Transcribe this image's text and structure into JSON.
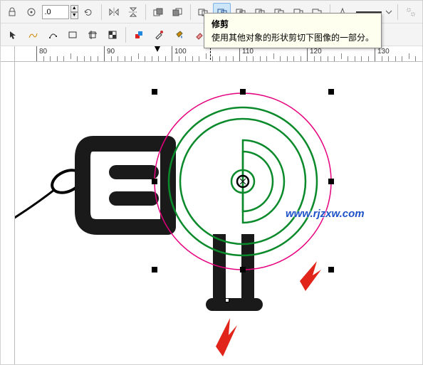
{
  "toolbar1": {
    "rotation_value": ".0",
    "icons": [
      "lock",
      "snap",
      "rotate",
      "mirror-h",
      "mirror-v",
      "front",
      "back",
      "weld",
      "trim",
      "intersect",
      "simplify",
      "front-minus",
      "back-minus",
      "boundary",
      "outline",
      "pen-pressure",
      "tablet",
      "dropdown",
      "align"
    ]
  },
  "toolbar2": {
    "icons": [
      "pointer",
      "freehand",
      "shape",
      "rect",
      "crop",
      "pattern",
      "color1",
      "color2",
      "eyedropper",
      "bucket",
      "eraser",
      "bitmap"
    ]
  },
  "tooltip": {
    "title": "修剪",
    "desc": "使用其他对象的形状剪切下图像的一部分。"
  },
  "ruler": {
    "labels": [
      "80",
      "90",
      "100",
      "110",
      "120",
      "130"
    ]
  },
  "watermark": "www.rjzxw.com"
}
